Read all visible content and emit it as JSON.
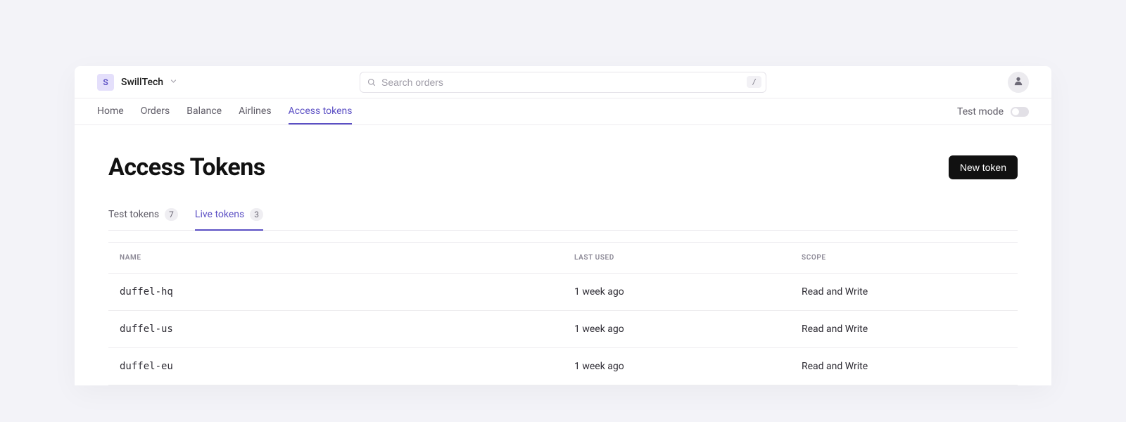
{
  "org": {
    "initial": "S",
    "name": "SwillTech"
  },
  "search": {
    "placeholder": "Search orders",
    "shortcut": "/"
  },
  "nav": {
    "items": [
      {
        "label": "Home"
      },
      {
        "label": "Orders"
      },
      {
        "label": "Balance"
      },
      {
        "label": "Airlines"
      },
      {
        "label": "Access tokens"
      }
    ],
    "active_index": 4,
    "testmode_label": "Test mode",
    "testmode_on": false
  },
  "page": {
    "title": "Access Tokens",
    "new_token_label": "New token"
  },
  "subtabs": {
    "items": [
      {
        "label": "Test tokens",
        "count": "7"
      },
      {
        "label": "Live tokens",
        "count": "3"
      }
    ],
    "active_index": 1
  },
  "table": {
    "columns": {
      "name": "NAME",
      "last_used": "LAST USED",
      "scope": "SCOPE"
    },
    "rows": [
      {
        "name": "duffel-hq",
        "last_used": "1 week ago",
        "scope": "Read and Write"
      },
      {
        "name": "duffel-us",
        "last_used": "1 week ago",
        "scope": "Read and Write"
      },
      {
        "name": "duffel-eu",
        "last_used": "1 week ago",
        "scope": "Read and Write"
      }
    ]
  }
}
